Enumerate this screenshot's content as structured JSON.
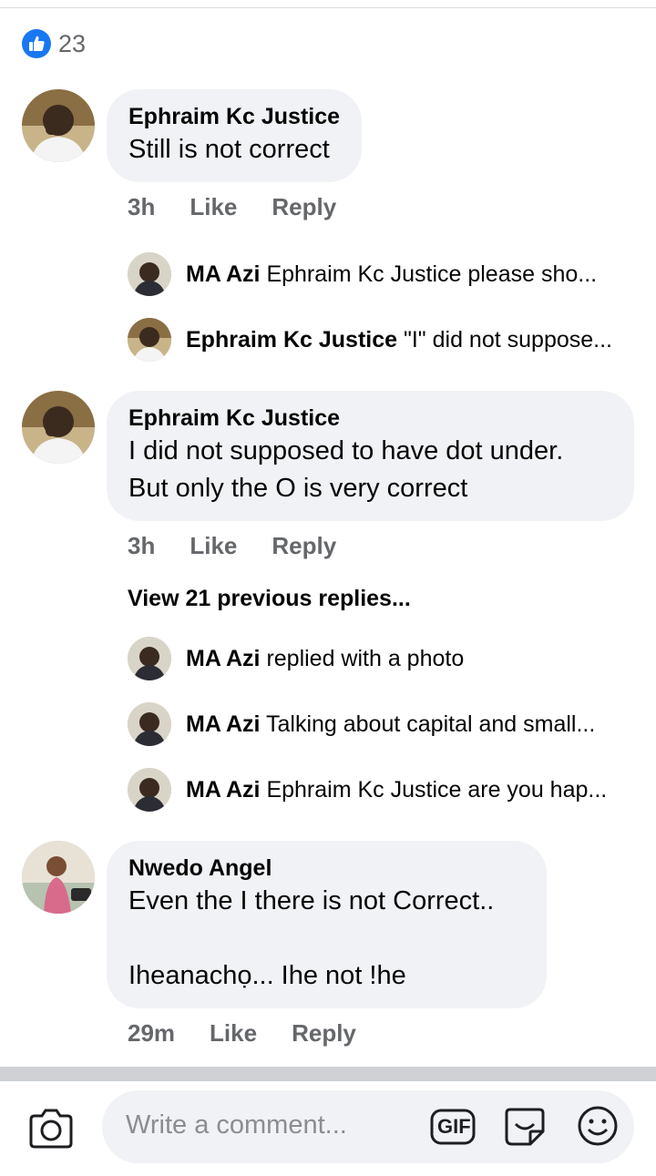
{
  "reactions": {
    "count": "23",
    "icon": "like-thumb-icon",
    "color": "#1877f2"
  },
  "comments": [
    {
      "author": "Ephraim Kc Justice",
      "text": "Still is not correct",
      "time": "3h",
      "like": "Like",
      "reply": "Reply",
      "replies": [
        {
          "author": "MA Azi",
          "snippet": "Ephraim Kc Justice  please sho..."
        },
        {
          "author": "Ephraim Kc Justice",
          "snippet": "\"I\" did not suppose..."
        }
      ]
    },
    {
      "author": "Ephraim Kc Justice",
      "text": "I did not supposed to have dot under.\nBut only the O is very correct",
      "time": "3h",
      "like": "Like",
      "reply": "Reply",
      "view_previous": "View 21 previous replies...",
      "replies": [
        {
          "author": "MA Azi",
          "snippet": "replied with a photo"
        },
        {
          "author": "MA Azi",
          "snippet": "Talking about capital and small..."
        },
        {
          "author": "MA Azi",
          "snippet": "Ephraim Kc Justice are you hap..."
        }
      ]
    },
    {
      "author": "Nwedo Angel",
      "text": "Even the I there is not Correct..\n\nIheanachọ... Ihe not !he",
      "time": "29m",
      "like": "Like",
      "reply": "Reply"
    }
  ],
  "composer": {
    "placeholder": "Write a comment...",
    "gif_label": "GIF",
    "icons": [
      "camera-icon",
      "gif-icon",
      "sticker-icon",
      "emoji-icon"
    ]
  }
}
